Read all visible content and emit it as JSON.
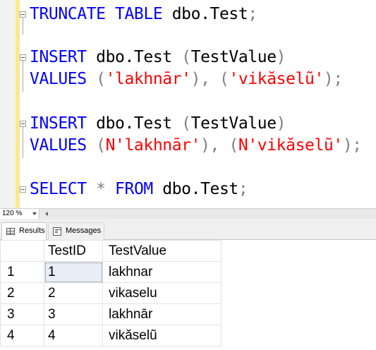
{
  "editor": {
    "lines": [
      [
        {
          "t": "TRUNCATE",
          "c": "kw"
        },
        {
          "t": " ",
          "c": "id"
        },
        {
          "t": "TABLE",
          "c": "kw"
        },
        {
          "t": " dbo.Test",
          "c": "id"
        },
        {
          "t": ";",
          "c": "gr"
        }
      ],
      [
        {
          "t": "INSERT",
          "c": "kw"
        },
        {
          "t": " dbo.Test ",
          "c": "id"
        },
        {
          "t": "(",
          "c": "gr"
        },
        {
          "t": "TestValue",
          "c": "id"
        },
        {
          "t": ")",
          "c": "gr"
        }
      ],
      [
        {
          "t": "VALUES",
          "c": "kw"
        },
        {
          "t": " ",
          "c": "id"
        },
        {
          "t": "(",
          "c": "gr"
        },
        {
          "t": "'lakhnār'",
          "c": "st"
        },
        {
          "t": "),",
          "c": "gr"
        },
        {
          "t": " ",
          "c": "id"
        },
        {
          "t": "(",
          "c": "gr"
        },
        {
          "t": "'vikăselũ'",
          "c": "st"
        },
        {
          "t": ");",
          "c": "gr"
        }
      ],
      [
        {
          "t": "INSERT",
          "c": "kw"
        },
        {
          "t": " dbo.Test ",
          "c": "id"
        },
        {
          "t": "(",
          "c": "gr"
        },
        {
          "t": "TestValue",
          "c": "id"
        },
        {
          "t": ")",
          "c": "gr"
        }
      ],
      [
        {
          "t": "VALUES",
          "c": "kw"
        },
        {
          "t": " ",
          "c": "id"
        },
        {
          "t": "(",
          "c": "gr"
        },
        {
          "t": "N'lakhnār'",
          "c": "st"
        },
        {
          "t": "),",
          "c": "gr"
        },
        {
          "t": " ",
          "c": "id"
        },
        {
          "t": "(",
          "c": "gr"
        },
        {
          "t": "N'vikăselũ'",
          "c": "st"
        },
        {
          "t": ");",
          "c": "gr"
        }
      ],
      [
        {
          "t": "SELECT",
          "c": "kw"
        },
        {
          "t": " ",
          "c": "id"
        },
        {
          "t": "*",
          "c": "gr"
        },
        {
          "t": " ",
          "c": "id"
        },
        {
          "t": "FROM",
          "c": "kw"
        },
        {
          "t": " dbo.Test",
          "c": "id"
        },
        {
          "t": ";",
          "c": "gr"
        }
      ]
    ],
    "colors": {
      "keyword": "#0000ff",
      "operator": "#808080",
      "string": "#ff0000",
      "identifier": "#000000"
    }
  },
  "status": {
    "zoom": "120 %"
  },
  "tabs": {
    "results": "Results",
    "messages": "Messages"
  },
  "grid": {
    "headers": [
      "",
      "TestID",
      "TestValue"
    ],
    "rows": [
      [
        "1",
        "1",
        "lakhnar"
      ],
      [
        "2",
        "2",
        "vikaselu"
      ],
      [
        "3",
        "3",
        "lakhnār"
      ],
      [
        "4",
        "4",
        "vikăselũ"
      ]
    ]
  }
}
